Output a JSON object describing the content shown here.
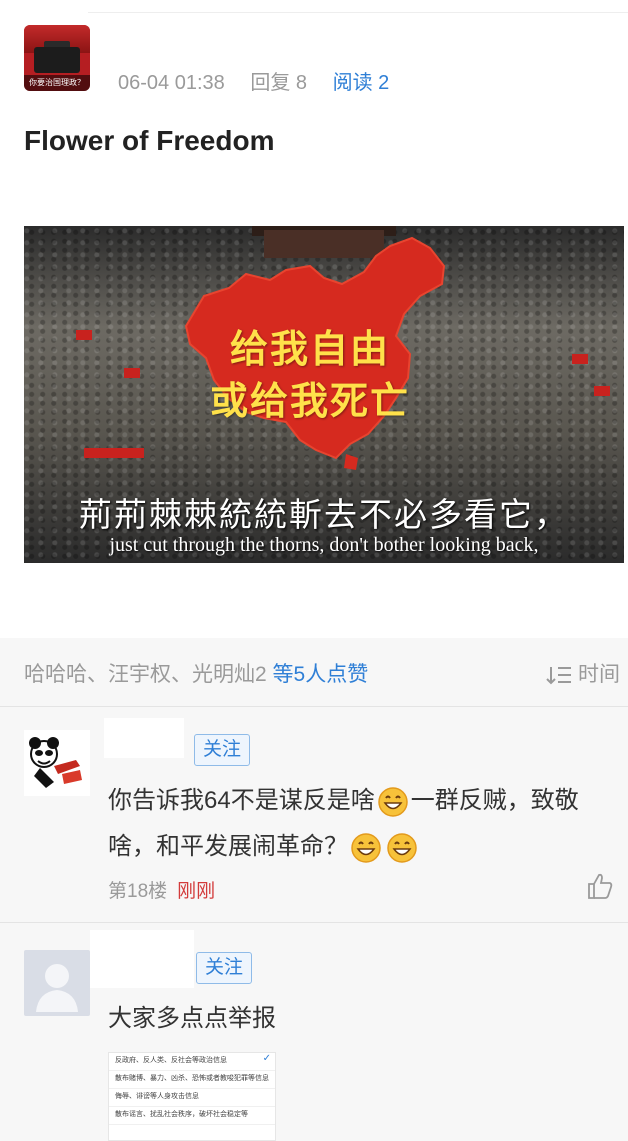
{
  "post": {
    "author_avatar_caption": "你要治国理政？",
    "date": "06-04 01:38",
    "reply_label": "回复 8",
    "read_label": "阅读 2",
    "title": "Flower of Freedom",
    "image": {
      "map_text_line1": "给我自由",
      "map_text_line2": "或给我死亡",
      "subtitle_cn": "荊荊棘棘統統斬去不必多看它，",
      "subtitle_en": "just cut through the thorns, don't bother looking back,"
    }
  },
  "likes": {
    "names": "哈哈哈、汪宇权、光明灿2",
    "count_label": "等5人点赞",
    "sort_label": "时间"
  },
  "comments": [
    {
      "follow_label": "关注",
      "text_part1": "你告诉我64不是谋反是啥",
      "text_part2": "一群反贼，致敬啥，和平发展闹革命？",
      "floor": "第18楼",
      "time": "刚刚"
    },
    {
      "follow_label": "关注",
      "text": "大家多点点举报",
      "report_options": [
        "反政府、反人类、反社会等政治信息",
        "散布赌博、暴力、凶杀、恐怖或者教唆犯罪等信息",
        "侮辱、诽谤等人身攻击信息",
        "散布谣言、扰乱社会秩序，破坏社会稳定等"
      ]
    }
  ],
  "colors": {
    "link_blue": "#2f7fd6",
    "time_red": "#d33b3b",
    "meta_gray": "#9a9a9a"
  },
  "icons": [
    "sort-icon",
    "thumb-up-icon",
    "grin-emoji-icon",
    "default-avatar-icon",
    "panda-avatar-icon",
    "check-icon"
  ]
}
